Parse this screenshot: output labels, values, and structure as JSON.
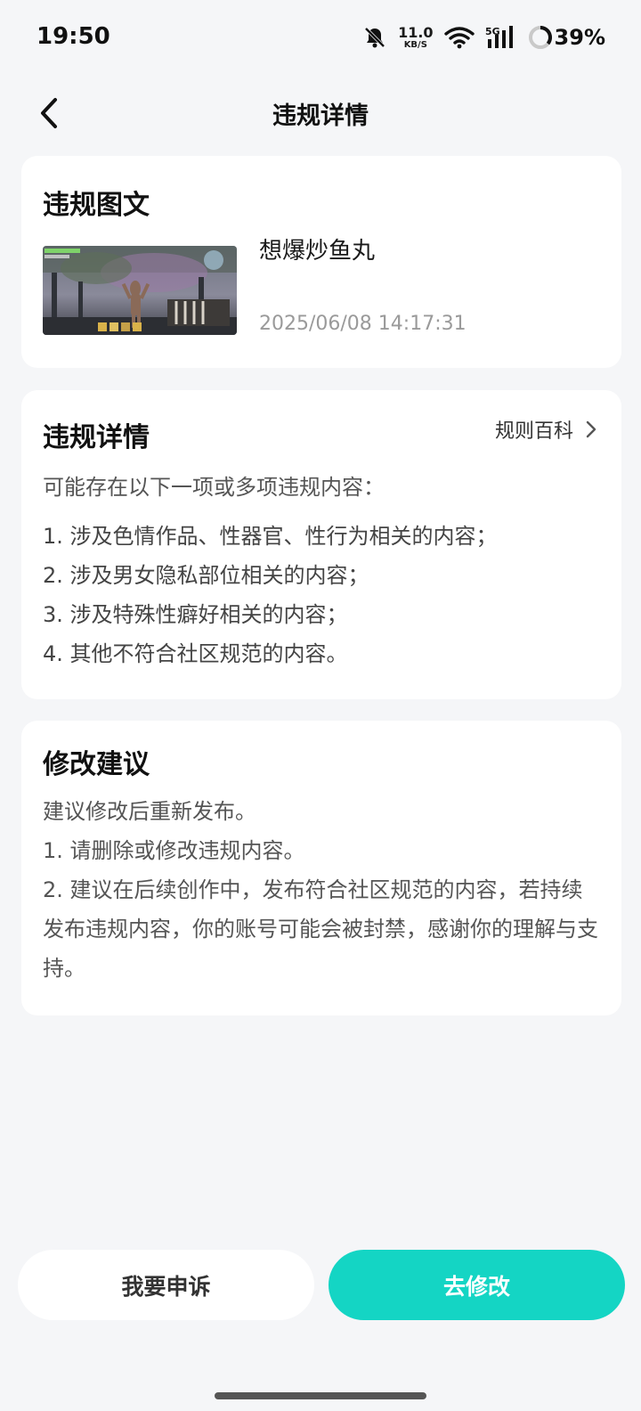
{
  "status_bar": {
    "time": "19:50",
    "net_speed_value": "11.0",
    "net_speed_unit": "KB/S",
    "network_type": "5G",
    "battery_percent": "39%",
    "icons": [
      "bell-muted-icon",
      "wifi-icon",
      "signal-icon",
      "battery-ring-icon"
    ]
  },
  "header": {
    "title": "违规详情",
    "back_icon": "chevron-left-icon"
  },
  "post_card": {
    "title": "违规图文",
    "post_title": "想爆炒鱼丸",
    "post_time": "2025/06/08 14:17:31"
  },
  "details_card": {
    "title": "违规详情",
    "rules_link": "规则百科",
    "intro": "可能存在以下一项或多项违规内容：",
    "items": [
      "1. 涉及色情作品、性器官、性行为相关的内容；",
      "2. 涉及男女隐私部位相关的内容；",
      "3. 涉及特殊性癖好相关的内容；",
      "4. 其他不符合社区规范的内容。"
    ]
  },
  "advice_card": {
    "title": "修改建议",
    "lines": [
      "建议修改后重新发布。",
      "1. 请删除或修改违规内容。",
      "2. 建议在后续创作中，发布符合社区规范的内容，若持续发布违规内容，你的账号可能会被封禁，感谢你的理解与支持。"
    ]
  },
  "actions": {
    "appeal_label": "我要申诉",
    "modify_label": "去修改"
  },
  "colors": {
    "accent": "#14d5c4",
    "background": "#f5f6f8",
    "card": "#ffffff"
  }
}
